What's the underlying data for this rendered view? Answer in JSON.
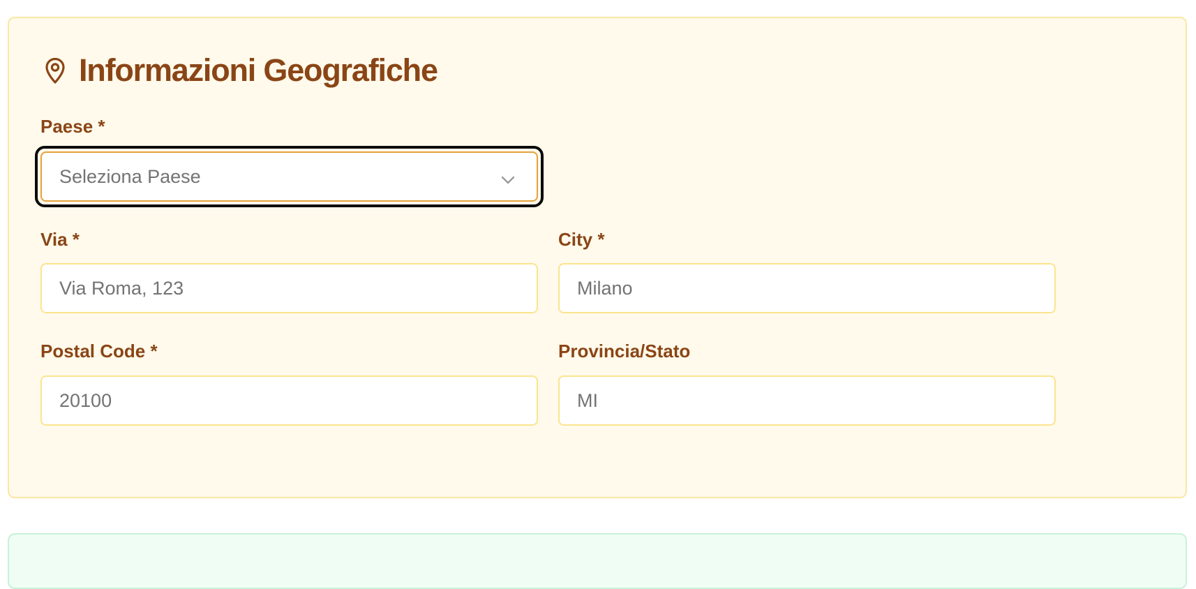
{
  "section": {
    "title": "Informazioni Geografiche",
    "icon": "map-pin-icon",
    "accent_color": "#8a4516",
    "background_color": "#fffaeb"
  },
  "fields": {
    "country": {
      "label": "Paese *",
      "placeholder": "Seleziona Paese",
      "icon": "chevron-down-icon"
    },
    "street": {
      "label": "Via *",
      "placeholder": "Via Roma, 123"
    },
    "city": {
      "label": "City *",
      "placeholder": "Milano"
    },
    "postal_code": {
      "label": "Postal Code *",
      "placeholder": "20100"
    },
    "province": {
      "label": "Provincia/Stato",
      "placeholder": "MI"
    }
  },
  "next_section": {
    "background_color": "#f0fdf5"
  }
}
